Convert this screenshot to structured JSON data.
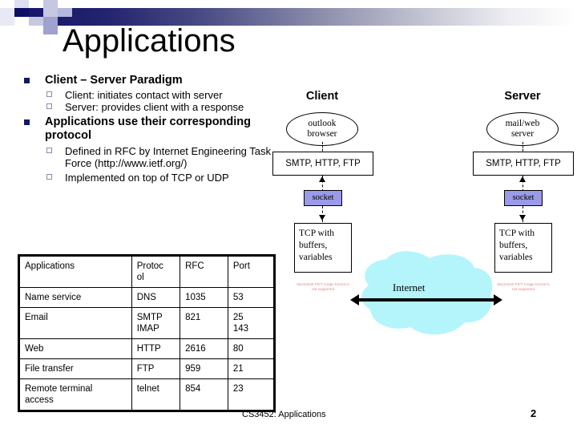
{
  "slide": {
    "title": "Applications",
    "footer_text": "CS3452: Applications",
    "page_number": "2"
  },
  "bullets": [
    {
      "level": 1,
      "text": "Client – Server Paradigm",
      "children": [
        {
          "level": 2,
          "text": "Client: initiates contact with server"
        },
        {
          "level": 2,
          "text": "Server: provides client with a response"
        }
      ]
    },
    {
      "level": 1,
      "text": "Applications use their corresponding protocol",
      "children": [
        {
          "level": 2,
          "text": "Defined in RFC by Internet Engineering Task Force (http://www.ietf.org/)"
        },
        {
          "level": 2,
          "text": "Implemented on top of TCP or UDP"
        }
      ]
    }
  ],
  "table": {
    "headers": [
      "Protoc\nol",
      "RFC",
      "Port"
    ],
    "header_app": "Applications",
    "rows": [
      {
        "app": "Name service",
        "protocol": "DNS",
        "rfc": "1035",
        "port": "53"
      },
      {
        "app": "Email",
        "protocol": "SMTP\nIMAP",
        "rfc": "821",
        "port": "25\n143"
      },
      {
        "app": "Web",
        "protocol": "HTTP",
        "rfc": "2616",
        "port": "80"
      },
      {
        "app": "File transfer",
        "protocol": "FTP",
        "rfc": "959",
        "port": "21"
      },
      {
        "app": "Remote terminal\naccess",
        "protocol": "telnet",
        "rfc": "854",
        "port": "23"
      }
    ]
  },
  "diagram": {
    "client": {
      "title": "Client",
      "app_label": "outlook\nbrowser",
      "protocol_label": "SMTP, HTTP, FTP",
      "socket_label": "socket",
      "transport_label": "TCP with\nbuffers,\nvariables",
      "pict_note": "Macintosh PICT image format is not supported"
    },
    "server": {
      "title": "Server",
      "app_label": "mail/web\nserver",
      "protocol_label": "SMTP, HTTP, FTP",
      "socket_label": "socket",
      "transport_label": "TCP with\nbuffers,\nvariables",
      "pict_note": "Macintosh PICT image format is not supported"
    },
    "network_label": "Internet"
  },
  "colors": {
    "header_gradient_start": "#16176b",
    "bullet_marker": "#111b63",
    "socket_fill": "#9a9ae8",
    "cloud_fill": "#b3f5fb",
    "pict_note": "#e08a8a"
  }
}
